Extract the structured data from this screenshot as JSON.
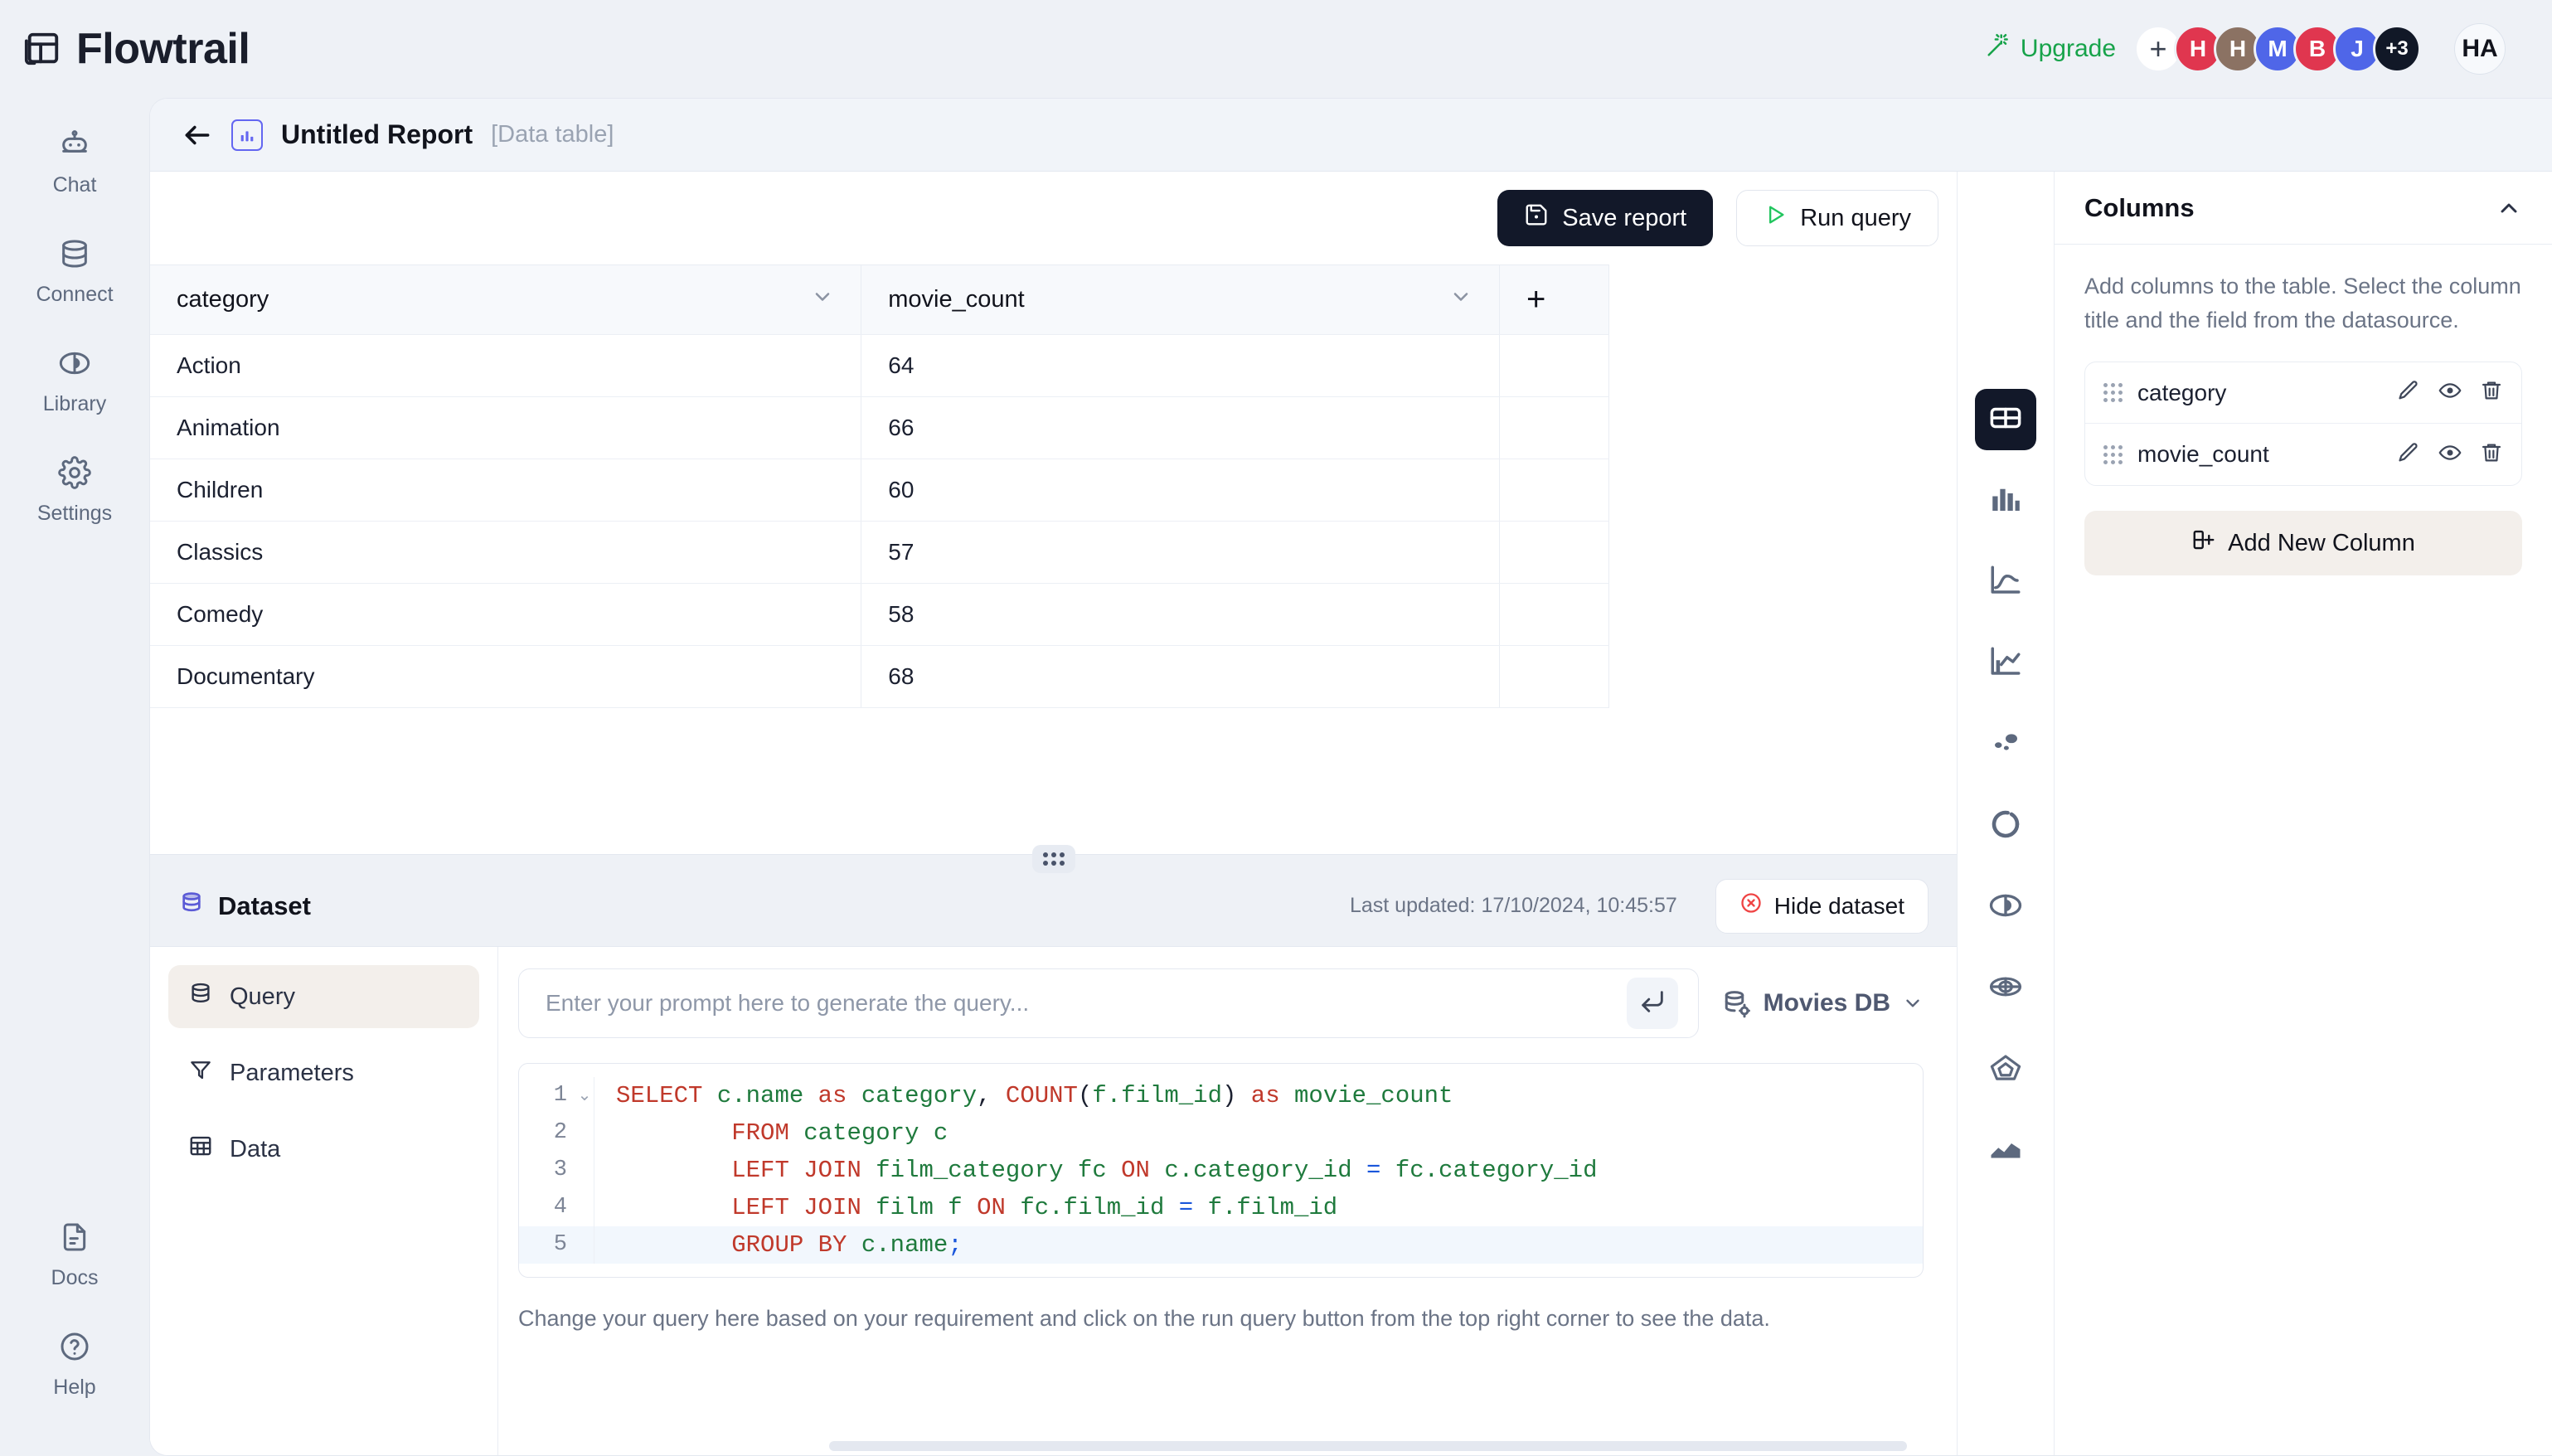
{
  "app": {
    "brand": "Flowtrail",
    "brand_icon": "table-layout-icon"
  },
  "topbar": {
    "upgrade_label": "Upgrade",
    "upgrade_icon": "magic-wand-icon",
    "upgrade_color": "#17a34a",
    "add_member_label": "+",
    "avatars": [
      {
        "initial": "H",
        "color": "#e0364f"
      },
      {
        "initial": "H",
        "color": "#8b7263"
      },
      {
        "initial": "M",
        "color": "#4f66e8"
      },
      {
        "initial": "B",
        "color": "#e0364f"
      },
      {
        "initial": "J",
        "color": "#4f66e8"
      },
      {
        "initial": "+3",
        "color": "#111827"
      }
    ],
    "self_avatar": "HA"
  },
  "sidebar": {
    "top_items": [
      {
        "label": "Chat",
        "icon": "robot-icon"
      },
      {
        "label": "Connect",
        "icon": "database-icon"
      },
      {
        "label": "Library",
        "icon": "pie-chart-icon"
      },
      {
        "label": "Settings",
        "icon": "gear-icon"
      }
    ],
    "bottom_items": [
      {
        "label": "Docs",
        "icon": "document-icon"
      },
      {
        "label": "Help",
        "icon": "question-circle-icon"
      }
    ]
  },
  "report": {
    "back_icon": "arrow-left-icon",
    "type_icon": "bar-chart-icon",
    "title": "Untitled Report",
    "subtitle": "[Data table]"
  },
  "actions": {
    "save_label": "Save report",
    "save_icon": "save-disk-icon",
    "run_label": "Run query",
    "run_icon": "play-icon",
    "run_icon_color": "#22c55e"
  },
  "table": {
    "columns": [
      "category",
      "movie_count"
    ],
    "add_column_label": "+",
    "rows": [
      [
        "Action",
        "64"
      ],
      [
        "Animation",
        "66"
      ],
      [
        "Children",
        "60"
      ],
      [
        "Classics",
        "57"
      ],
      [
        "Comedy",
        "58"
      ],
      [
        "Documentary",
        "68"
      ]
    ]
  },
  "chart_types": [
    {
      "name": "table-chart-icon",
      "active": true
    },
    {
      "name": "bar-chart-icon",
      "active": false
    },
    {
      "name": "line-chart-icon",
      "active": false
    },
    {
      "name": "combo-chart-icon",
      "active": false
    },
    {
      "name": "scatter-chart-icon",
      "active": false
    },
    {
      "name": "donut-chart-icon",
      "active": false
    },
    {
      "name": "pie-chart-icon",
      "active": false
    },
    {
      "name": "radial-chart-icon",
      "active": false
    },
    {
      "name": "radar-chart-icon",
      "active": false
    },
    {
      "name": "area-chart-icon",
      "active": false
    }
  ],
  "columns_panel": {
    "title": "Columns",
    "collapse_icon": "chevron-up-icon",
    "description": "Add columns to the table. Select the column title and the field from the datasource.",
    "items": [
      {
        "name": "category"
      },
      {
        "name": "movie_count"
      }
    ],
    "row_actions": [
      "pencil-icon",
      "eye-icon",
      "trash-icon"
    ],
    "add_button_label": "Add New Column",
    "add_button_icon": "add-column-icon"
  },
  "dataset": {
    "title": "Dataset",
    "title_icon": "database-stack-icon",
    "last_updated": "Last updated: 17/10/2024, 10:45:57",
    "hide_label": "Hide dataset",
    "hide_icon": "circle-x-icon",
    "tabs": [
      {
        "label": "Query",
        "icon": "database-icon",
        "active": true
      },
      {
        "label": "Parameters",
        "icon": "funnel-icon",
        "active": false
      },
      {
        "label": "Data",
        "icon": "grid-icon",
        "active": false
      }
    ],
    "prompt_placeholder": "Enter your prompt here to generate the query...",
    "prompt_value": "",
    "submit_icon": "enter-arrow-icon",
    "datasource_name": "Movies DB",
    "datasource_icon": "database-gear-icon",
    "datasource_chevron": "chevron-down-icon",
    "help_text": "Change your query here based on your requirement and click on the run query button from the top right corner to see the data.",
    "code_lines": [
      {
        "number": "1",
        "fold": "⌄",
        "highlighted": false,
        "tokens": [
          {
            "t": "SELECT",
            "c": "kw"
          },
          {
            "t": " ",
            "c": "pn"
          },
          {
            "t": "c.name",
            "c": "id"
          },
          {
            "t": " ",
            "c": "pn"
          },
          {
            "t": "as",
            "c": "kw"
          },
          {
            "t": " ",
            "c": "pn"
          },
          {
            "t": "category",
            "c": "id"
          },
          {
            "t": ", ",
            "c": "pn"
          },
          {
            "t": "COUNT",
            "c": "kw"
          },
          {
            "t": "(",
            "c": "pn"
          },
          {
            "t": "f.film_id",
            "c": "id"
          },
          {
            "t": ")",
            "c": "pn"
          },
          {
            "t": " ",
            "c": "pn"
          },
          {
            "t": "as",
            "c": "kw"
          },
          {
            "t": " ",
            "c": "pn"
          },
          {
            "t": "movie_count",
            "c": "id"
          }
        ]
      },
      {
        "number": "2",
        "fold": "",
        "highlighted": false,
        "tokens": [
          {
            "t": "        ",
            "c": "pn"
          },
          {
            "t": "FROM",
            "c": "kw"
          },
          {
            "t": " ",
            "c": "pn"
          },
          {
            "t": "category c",
            "c": "id"
          }
        ]
      },
      {
        "number": "3",
        "fold": "",
        "highlighted": false,
        "tokens": [
          {
            "t": "        ",
            "c": "pn"
          },
          {
            "t": "LEFT JOIN",
            "c": "kw"
          },
          {
            "t": " ",
            "c": "pn"
          },
          {
            "t": "film_category fc",
            "c": "id"
          },
          {
            "t": " ",
            "c": "pn"
          },
          {
            "t": "ON",
            "c": "kw"
          },
          {
            "t": " ",
            "c": "pn"
          },
          {
            "t": "c.category_id",
            "c": "id"
          },
          {
            "t": " ",
            "c": "pn"
          },
          {
            "t": "=",
            "c": "op"
          },
          {
            "t": " ",
            "c": "pn"
          },
          {
            "t": "fc.category_id",
            "c": "id"
          }
        ]
      },
      {
        "number": "4",
        "fold": "",
        "highlighted": false,
        "tokens": [
          {
            "t": "        ",
            "c": "pn"
          },
          {
            "t": "LEFT JOIN",
            "c": "kw"
          },
          {
            "t": " ",
            "c": "pn"
          },
          {
            "t": "film f",
            "c": "id"
          },
          {
            "t": " ",
            "c": "pn"
          },
          {
            "t": "ON",
            "c": "kw"
          },
          {
            "t": " ",
            "c": "pn"
          },
          {
            "t": "fc.film_id",
            "c": "id"
          },
          {
            "t": " ",
            "c": "pn"
          },
          {
            "t": "=",
            "c": "op"
          },
          {
            "t": " ",
            "c": "pn"
          },
          {
            "t": "f.film_id",
            "c": "id"
          }
        ]
      },
      {
        "number": "5",
        "fold": "",
        "highlighted": true,
        "tokens": [
          {
            "t": "        ",
            "c": "pn"
          },
          {
            "t": "GROUP BY",
            "c": "kw"
          },
          {
            "t": " ",
            "c": "pn"
          },
          {
            "t": "c.name",
            "c": "id"
          },
          {
            "t": ";",
            "c": "op"
          }
        ]
      }
    ]
  }
}
